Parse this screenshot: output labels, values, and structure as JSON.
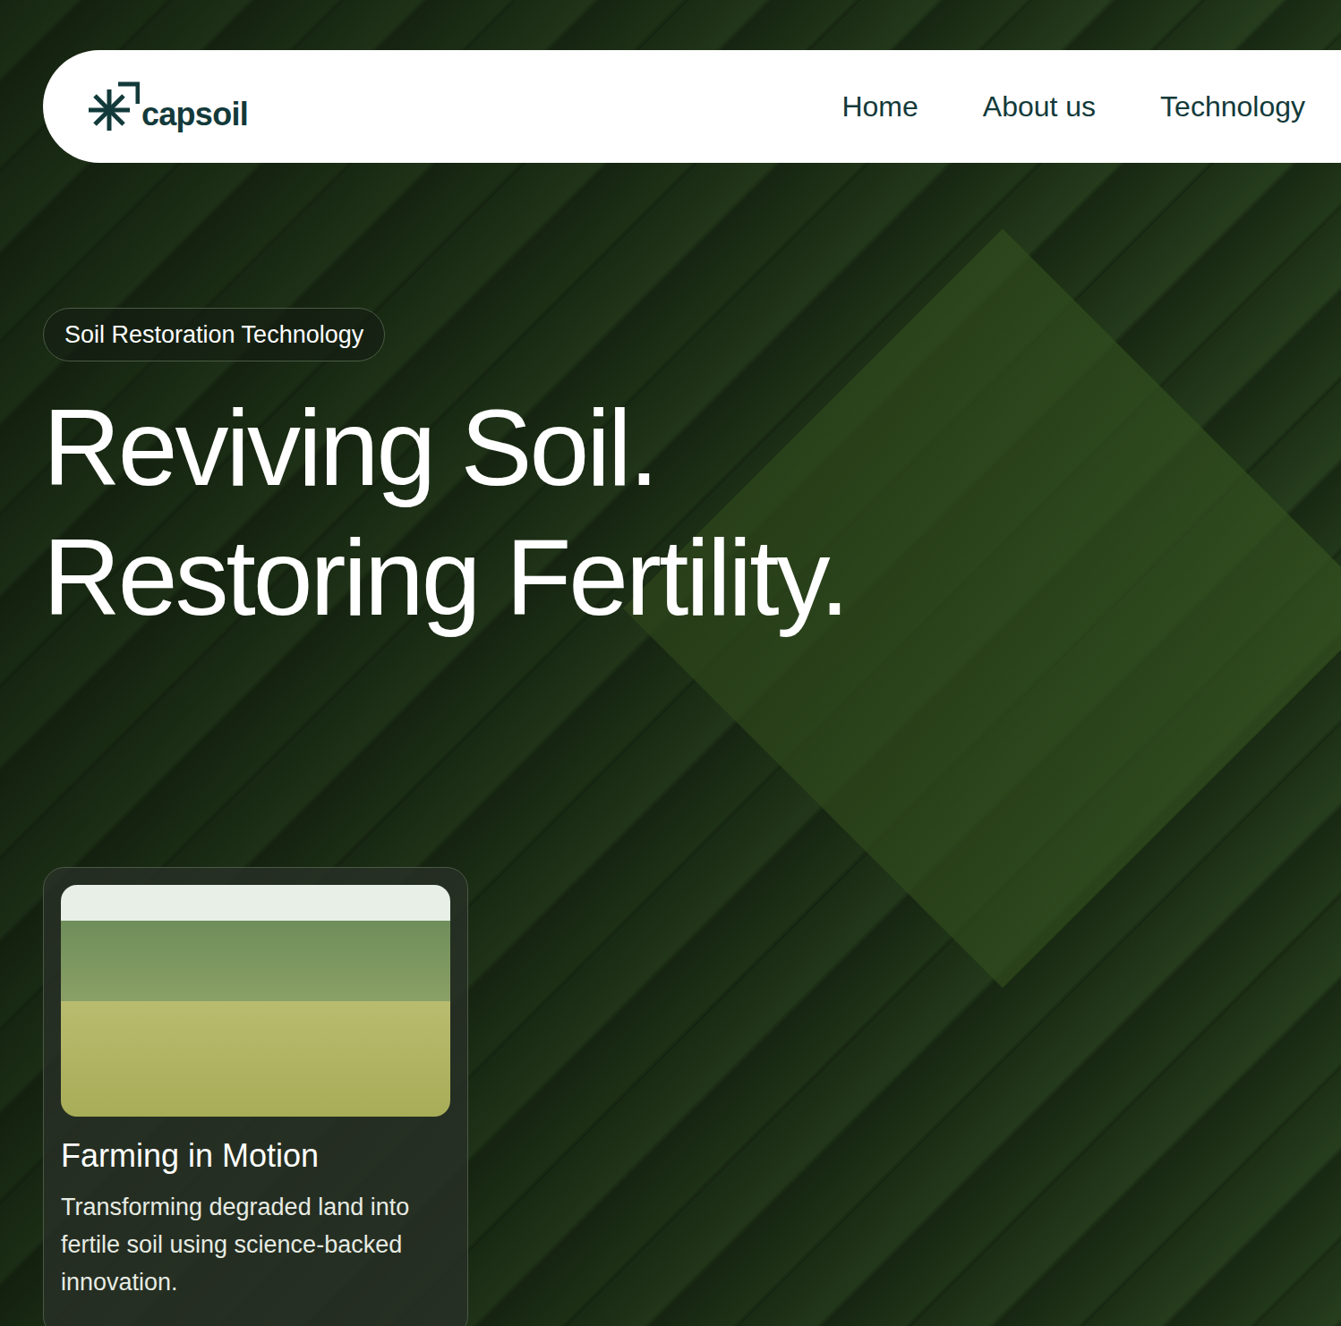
{
  "nav": {
    "logo": "capsoil",
    "links": [
      {
        "label": "Home"
      },
      {
        "label": "About us"
      },
      {
        "label": "Technology"
      }
    ]
  },
  "hero": {
    "badge": "Soil Restoration Technology",
    "headline": [
      "Reviving Soil.",
      "Restoring Fertility."
    ]
  },
  "card": {
    "title": "Farming in Motion",
    "description": "Transforming degraded land into fertile soil using science-backed innovation."
  }
}
